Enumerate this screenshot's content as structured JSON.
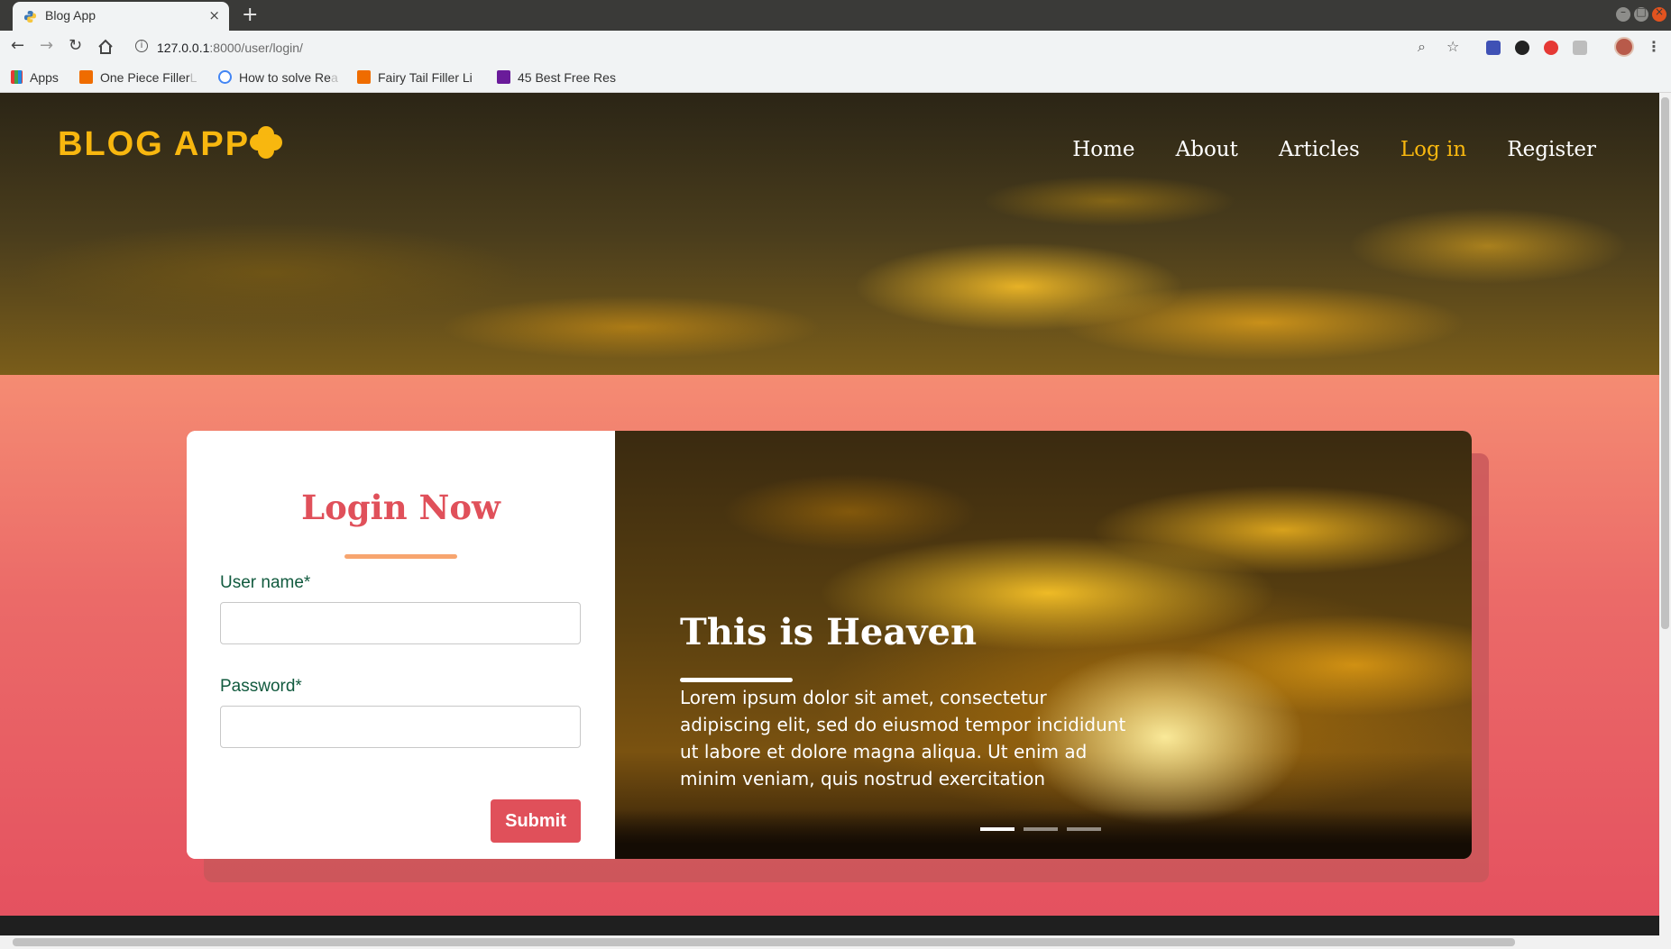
{
  "browser": {
    "tab_title": "Blog App",
    "tab_close": "×",
    "new_tab": "+",
    "url_host": "127.0.0.1",
    "url_rest": ":8000/user/login/",
    "bookmarks": [
      {
        "label": "Apps",
        "icon": "apps-grid-icon"
      },
      {
        "label": "One Piece Filler",
        "faded": "L",
        "icon": "filler-icon"
      },
      {
        "label": "How to solve Re",
        "faded": "a",
        "icon": "search-icon"
      },
      {
        "label": "Fairy Tail Filler Li",
        "faded": "",
        "icon": "filler-icon"
      },
      {
        "label": "45 Best Free Res",
        "faded": "",
        "icon": "colorlib-icon"
      }
    ]
  },
  "site": {
    "logo": "BLOG APP",
    "brand_color": "#f8b70f",
    "nav": [
      {
        "label": "Home"
      },
      {
        "label": "About"
      },
      {
        "label": "Articles"
      },
      {
        "label": "Log in",
        "active": true
      },
      {
        "label": "Register"
      }
    ]
  },
  "login": {
    "title": "Login Now",
    "username_label": "User name*",
    "username_value": "",
    "password_label": "Password*",
    "password_value": "",
    "submit_label": "Submit",
    "accent_color": "#e0505a"
  },
  "slider": {
    "title": "This is Heaven",
    "text": "Lorem ipsum dolor sit amet, consectetur adipiscing elit, sed do eiusmod tempor incididunt ut labore et dolore magna aliqua. Ut enim ad minim veniam, quis nostrud exercitation",
    "slide_count": 3,
    "active_slide": 1
  }
}
